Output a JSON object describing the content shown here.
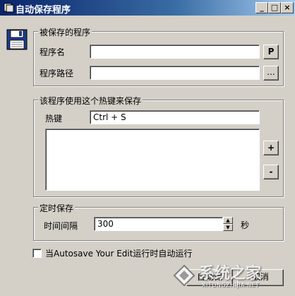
{
  "window": {
    "title": "自动保存程序",
    "minimize": "_",
    "maximize": "□",
    "close": "×"
  },
  "protected_group": {
    "title": "被保存的程序",
    "program_name_label": "程序名",
    "program_name_value": "",
    "pick_button": "P",
    "program_path_label": "程序路径",
    "program_path_value": "",
    "browse_button": "..."
  },
  "hotkey_group": {
    "title": "该程序使用这个热键来保存",
    "hotkey_label": "热键",
    "hotkey_value": "Ctrl + S",
    "add_button": "+",
    "remove_button": "-"
  },
  "timer_group": {
    "title": "定时保存",
    "interval_label": "时间间隔",
    "interval_value": "300",
    "unit": "秒"
  },
  "autorun": {
    "label": "当Autosave Your Edit运行时自动运行",
    "checked": false
  },
  "footer": {
    "ok_button": "自动保",
    "cancel_button": "取消"
  },
  "watermark": {
    "text": "系统之家",
    "subtext": "XITONGZHIJIA.NET"
  }
}
